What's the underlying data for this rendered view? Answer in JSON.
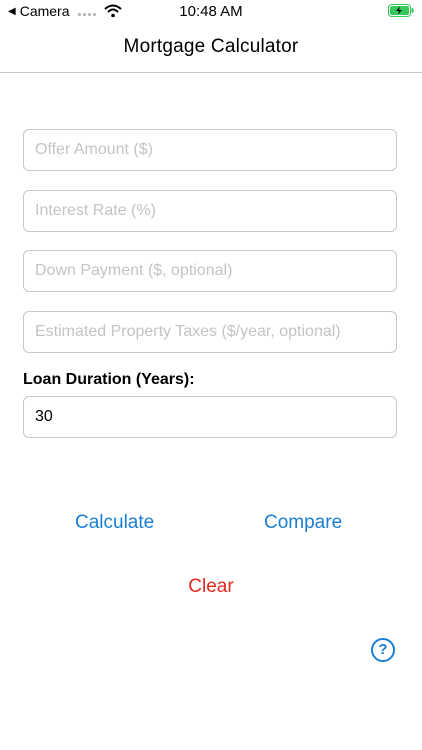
{
  "status_bar": {
    "back_label": "Camera",
    "time": "10:48 AM"
  },
  "nav": {
    "title": "Mortgage Calculator"
  },
  "form": {
    "offer_amount": {
      "placeholder": "Offer Amount ($)",
      "value": ""
    },
    "interest_rate": {
      "placeholder": "Interest Rate (%)",
      "value": ""
    },
    "down_payment": {
      "placeholder": "Down Payment ($, optional)",
      "value": ""
    },
    "property_taxes": {
      "placeholder": "Estimated Property Taxes ($/year, optional)",
      "value": ""
    },
    "loan_duration_label": "Loan Duration (Years):",
    "loan_duration_value": "30"
  },
  "actions": {
    "calculate": "Calculate",
    "compare": "Compare",
    "clear": "Clear",
    "help": "?"
  },
  "colors": {
    "accent": "#1a7fd4",
    "destructive": "#e02a1f",
    "battery": "#34c759"
  },
  "icons": [
    "back-arrow-icon",
    "signal-icon",
    "wifi-icon",
    "battery-charging-icon",
    "help-icon"
  ]
}
